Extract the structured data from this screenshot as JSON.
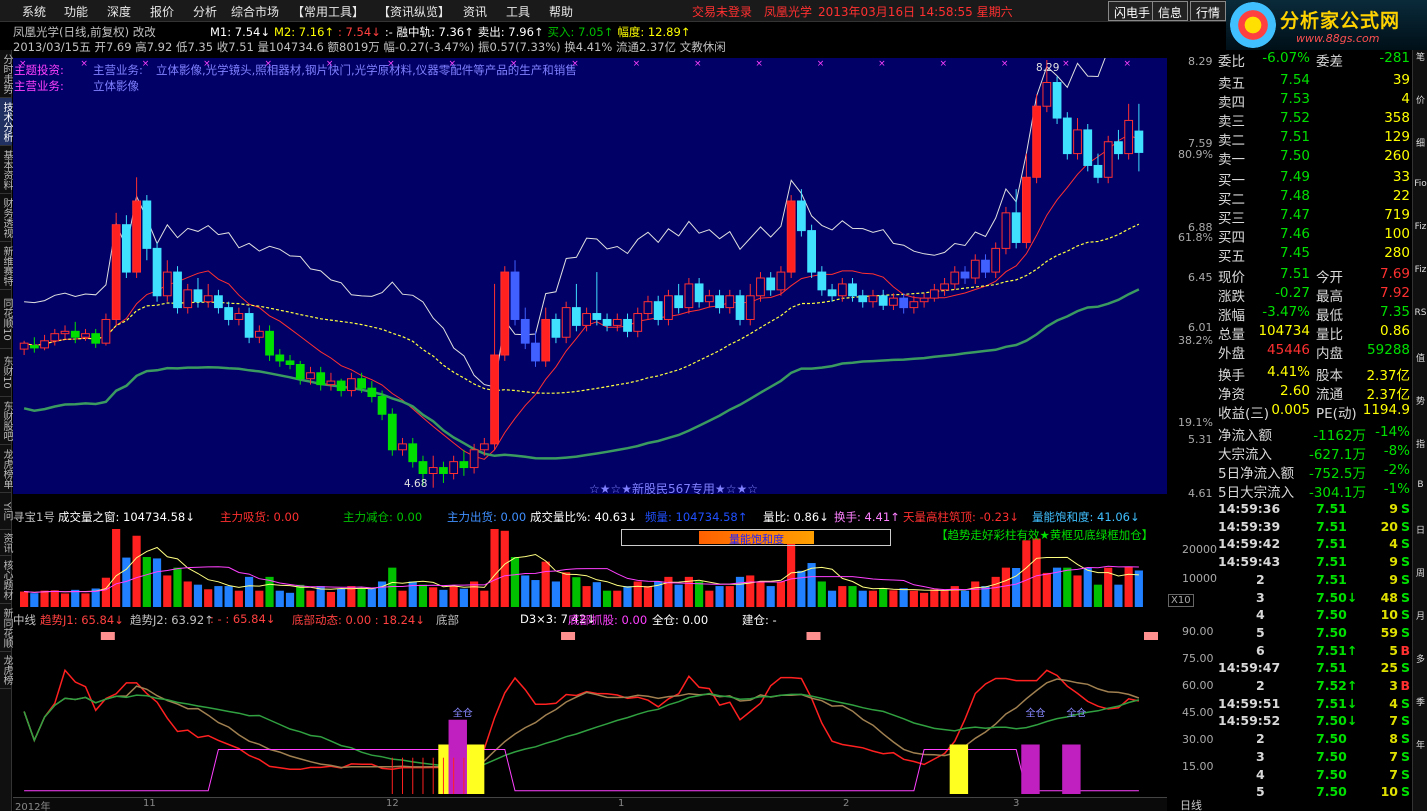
{
  "menu": [
    "系统",
    "功能",
    "深度",
    "报价",
    "分析",
    "综合市场",
    "【常用工具】",
    "【资讯纵览】",
    "资讯",
    "工具",
    "帮助"
  ],
  "status": {
    "login": "交易未登录",
    "stock": "凤凰光学",
    "datetime": "2013年03月16日 14:58:55 星期六"
  },
  "buttons": [
    "闪电手",
    "信息",
    "行情"
  ],
  "logo": {
    "title": "分析家公式网",
    "url": "www.88gs.com"
  },
  "left_tabs": [
    "分时走势",
    "技术分析",
    "基本资料",
    "财务透视",
    "新维赛特",
    "同花顺10",
    "东财10",
    "东财股吧",
    "龙虎榜单",
    "Yi问",
    "资讯",
    "核心题材",
    "新同花顺",
    "龙虎榜"
  ],
  "header": {
    "title": "凤凰光学(日线,前复权) 改改",
    "ohlc": "2013/03/15五 开7.69 高7.92 低7.35 收7.51 量104734.6 额8019万 幅-0.27(-3.47%) 振0.57(7.33%) 换4.41% 流通2.37亿 文教休闲",
    "indicators": [
      {
        "text": "M1: 7.54↓",
        "color": "#ffffff"
      },
      {
        "text": "M2: 7.16↑",
        "color": "#ffff00"
      },
      {
        "text": ": 7.54↓",
        "color": "#ff4040"
      },
      {
        "text": ":- 融中轨: 7.36↑",
        "color": "#ffffff"
      },
      {
        "text": "卖出: 7.96↑",
        "color": "#ffffff"
      },
      {
        "text": "买入: 7.05↑",
        "color": "#00c000"
      },
      {
        "text": "幅度: 12.89↑",
        "color": "#ffff00"
      }
    ]
  },
  "main_panel": {
    "theme_label": "主题投资:",
    "theme_sub": "主营业务:",
    "theme_text": "立体影像,光学镜头,照相器材,钢片快门,光学原材料,仪器零配件等产品的生产和销售",
    "business_label": "主营业务:",
    "business_text": "立体影像",
    "caption": "☆★☆★新股民567专用★☆★☆",
    "high_label": "8.29",
    "low_label": "4.68",
    "price_axis": [
      "8.29",
      "7.59",
      "6.88",
      "6.45",
      "6.01",
      "5.31",
      "4.61"
    ],
    "pct_axis": [
      "80.9%",
      "61.8%",
      "38.2%",
      "19.1%"
    ]
  },
  "vol_panel": {
    "items": [
      {
        "text": "寻宝1号",
        "color": "#c0c0c0"
      },
      {
        "text": "成交量之窗: 104734.58↓",
        "color": "#ffffff"
      },
      {
        "text": "主力吸货: 0.00",
        "color": "#ff3030"
      },
      {
        "text": "主力减仓: 0.00",
        "color": "#00c000"
      },
      {
        "text": "主力出货: 0.00",
        "color": "#4090ff"
      },
      {
        "text": "成交量比%: 40.63↓",
        "color": "#ffffff"
      },
      {
        "text": "频量: 104734.58↑",
        "color": "#2050ff"
      },
      {
        "text": "量比: 0.86↓",
        "color": "#ffffff"
      },
      {
        "text": "换手: 4.41↑",
        "color": "#ff80ff"
      },
      {
        "text": "天量高柱筑顶: -0.23↓",
        "color": "#ff3030"
      },
      {
        "text": "量能饱和度: 41.06↓",
        "color": "#40c0ff"
      }
    ],
    "box_label": "量能饱和度",
    "note": "【趋势走好彩柱有效★黄框见底绿框加仓】",
    "axis": [
      "20000",
      "10000"
    ],
    "unit": "X10"
  },
  "osc_panel": {
    "items": [
      {
        "text": "中线",
        "color": "#c0c0c0"
      },
      {
        "text": "趋势J1: 65.84↓",
        "color": "#ff4040"
      },
      {
        "text": "趋势J2: 63.92↑",
        "color": "#c0c0c0"
      },
      {
        "text": ": - : 65.84↓",
        "color": "#ff4040"
      },
      {
        "text": "底部动态: 0.00 : 18.24↓",
        "color": "#ff4040"
      },
      {
        "text": "底部",
        "color": "#c0c0c0"
      },
      {
        "text": "D3×3: 7.42↓",
        "color": "#ffffff"
      },
      {
        "text": "底部抓股: 0.00",
        "color": "#ff40ff"
      },
      {
        "text": "全仓: 0.00",
        "color": "#ffffff"
      },
      {
        "text": "建仓: -",
        "color": "#ffffff"
      }
    ],
    "axis": [
      "90.00",
      "75.00",
      "60.00",
      "45.00",
      "30.00",
      "15.00"
    ],
    "full_label": "全仓"
  },
  "x_axis": [
    "2012年",
    "11",
    "12",
    "1",
    "2",
    "3"
  ],
  "period": "日线",
  "quote": {
    "wei": {
      "label": "委比",
      "value": "-6.07%",
      "label2": "委差",
      "value2": "-281"
    },
    "asks": [
      {
        "label": "卖五",
        "price": "7.54",
        "vol": "39"
      },
      {
        "label": "卖四",
        "price": "7.53",
        "vol": "4"
      },
      {
        "label": "卖三",
        "price": "7.52",
        "vol": "358"
      },
      {
        "label": "卖二",
        "price": "7.51",
        "vol": "129"
      },
      {
        "label": "卖一",
        "price": "7.50",
        "vol": "260"
      }
    ],
    "bids": [
      {
        "label": "买一",
        "price": "7.49",
        "vol": "33"
      },
      {
        "label": "买二",
        "price": "7.48",
        "vol": "22"
      },
      {
        "label": "买三",
        "price": "7.47",
        "vol": "719"
      },
      {
        "label": "买四",
        "price": "7.46",
        "vol": "100"
      },
      {
        "label": "买五",
        "price": "7.45",
        "vol": "280"
      }
    ],
    "stats1": [
      {
        "l": "现价",
        "v": "7.51",
        "c": "#00e000",
        "l2": "今开",
        "v2": "7.69",
        "c2": "#ff3030"
      },
      {
        "l": "涨跌",
        "v": "-0.27",
        "c": "#00e000",
        "l2": "最高",
        "v2": "7.92",
        "c2": "#ff3030"
      },
      {
        "l": "涨幅",
        "v": "-3.47%",
        "c": "#00e000",
        "l2": "最低",
        "v2": "7.35",
        "c2": "#00e000"
      },
      {
        "l": "总量",
        "v": "104734",
        "c": "#ffff00",
        "l2": "量比",
        "v2": "0.86",
        "c2": "#ffff00"
      },
      {
        "l": "外盘",
        "v": "45446",
        "c": "#ff3030",
        "l2": "内盘",
        "v2": "59288",
        "c2": "#00e000"
      }
    ],
    "stats2": [
      {
        "l": "换手",
        "v": "4.41%",
        "c": "#ffff00",
        "l2": "股本",
        "v2": "2.37亿",
        "c2": "#ffff00"
      },
      {
        "l": "净资",
        "v": "2.60",
        "c": "#ffff00",
        "l2": "流通",
        "v2": "2.37亿",
        "c2": "#ffff00"
      },
      {
        "l": "收益(三)",
        "v": "0.005",
        "c": "#ffff00",
        "l2": "PE(动)",
        "v2": "1194.9",
        "c2": "#ffff00"
      }
    ],
    "flows": [
      {
        "l": "净流入额",
        "v": "-1162万",
        "v2": "-14%"
      },
      {
        "l": "大宗流入",
        "v": "-627.1万",
        "v2": "-8%"
      },
      {
        "l": "5日净流入额",
        "v": "-752.5万",
        "v2": "-2%"
      },
      {
        "l": "5日大宗流入",
        "v": "-304.1万",
        "v2": "-1%"
      }
    ]
  },
  "ticks": [
    {
      "t": "14:59:36",
      "p": "7.51",
      "v": "9",
      "bs": "S"
    },
    {
      "t": "14:59:39",
      "p": "7.51",
      "v": "20",
      "bs": "S"
    },
    {
      "t": "14:59:42",
      "p": "7.51",
      "v": "4",
      "bs": "S"
    },
    {
      "t": "14:59:43",
      "p": "7.51",
      "v": "9",
      "bs": "S"
    },
    {
      "t": "2",
      "p": "7.51",
      "v": "9",
      "bs": "S"
    },
    {
      "t": "3",
      "p": "7.50↓",
      "v": "48",
      "bs": "S"
    },
    {
      "t": "4",
      "p": "7.50",
      "v": "10",
      "bs": "S"
    },
    {
      "t": "5",
      "p": "7.50",
      "v": "59",
      "bs": "S"
    },
    {
      "t": "6",
      "p": "7.51↑",
      "v": "5",
      "bs": "B"
    },
    {
      "t": "14:59:47",
      "p": "7.51",
      "v": "25",
      "bs": "S"
    },
    {
      "t": "2",
      "p": "7.52↑",
      "v": "3",
      "bs": "B"
    },
    {
      "t": "14:59:51",
      "p": "7.51↓",
      "v": "4",
      "bs": "S"
    },
    {
      "t": "14:59:52",
      "p": "7.50↓",
      "v": "7",
      "bs": "S"
    },
    {
      "t": "2",
      "p": "7.50",
      "v": "8",
      "bs": "S"
    },
    {
      "t": "3",
      "p": "7.50",
      "v": "7",
      "bs": "S"
    },
    {
      "t": "4",
      "p": "7.50",
      "v": "7",
      "bs": "S"
    },
    {
      "t": "5",
      "p": "7.50",
      "v": "10",
      "bs": "S"
    }
  ],
  "far_right": [
    "笔",
    "价",
    "细",
    "Fio",
    "Fiz",
    "Fiz",
    "RS",
    "值",
    "势",
    "指",
    "B",
    "日",
    "周",
    "月",
    "多",
    "季",
    "年"
  ],
  "chart_data": {
    "type": "candlestick",
    "price_min": 4.61,
    "price_max": 8.29,
    "candles": [
      [
        5.85,
        5.9,
        5.8,
        5.92
      ],
      [
        5.88,
        5.86,
        5.82,
        5.95
      ],
      [
        5.86,
        5.92,
        5.84,
        5.97
      ],
      [
        5.92,
        5.98,
        5.88,
        6.02
      ],
      [
        5.98,
        6.0,
        5.93,
        6.05
      ],
      [
        6.0,
        5.95,
        5.9,
        6.08
      ],
      [
        5.95,
        5.98,
        5.92,
        6.02
      ],
      [
        5.98,
        5.9,
        5.86,
        6.02
      ],
      [
        5.9,
        6.1,
        5.88,
        6.15
      ],
      [
        6.1,
        6.9,
        6.05,
        7.0
      ],
      [
        6.9,
        6.5,
        6.45,
        6.98
      ],
      [
        6.5,
        7.1,
        6.45,
        7.3
      ],
      [
        7.1,
        6.7,
        6.6,
        7.15
      ],
      [
        6.7,
        6.3,
        6.25,
        6.75
      ],
      [
        6.3,
        6.5,
        6.25,
        6.6
      ],
      [
        6.5,
        6.2,
        6.15,
        6.55
      ],
      [
        6.2,
        6.35,
        6.15,
        6.4
      ],
      [
        6.35,
        6.25,
        6.2,
        6.45
      ],
      [
        6.25,
        6.3,
        6.2,
        6.4
      ],
      [
        6.3,
        6.2,
        6.15,
        6.35
      ],
      [
        6.2,
        6.1,
        6.05,
        6.25
      ],
      [
        6.1,
        6.15,
        6.05,
        6.2
      ],
      [
        6.15,
        5.95,
        5.9,
        6.2
      ],
      [
        5.95,
        6.0,
        5.9,
        6.05
      ],
      [
        6.0,
        5.8,
        5.75,
        6.05
      ],
      [
        5.8,
        5.75,
        5.7,
        5.85
      ],
      [
        5.75,
        5.72,
        5.68,
        5.8
      ],
      [
        5.72,
        5.6,
        5.55,
        5.75
      ],
      [
        5.6,
        5.65,
        5.55,
        5.7
      ],
      [
        5.65,
        5.55,
        5.5,
        5.7
      ],
      [
        5.55,
        5.58,
        5.5,
        5.65
      ],
      [
        5.58,
        5.5,
        5.45,
        5.6
      ],
      [
        5.5,
        5.6,
        5.45,
        5.65
      ],
      [
        5.6,
        5.52,
        5.48,
        5.65
      ],
      [
        5.52,
        5.45,
        5.4,
        5.58
      ],
      [
        5.45,
        5.3,
        5.25,
        5.5
      ],
      [
        5.3,
        5.0,
        4.95,
        5.35
      ],
      [
        5.0,
        5.05,
        4.95,
        5.1
      ],
      [
        5.05,
        4.9,
        4.85,
        5.1
      ],
      [
        4.9,
        4.8,
        4.7,
        4.95
      ],
      [
        4.8,
        4.85,
        4.68,
        4.95
      ],
      [
        4.85,
        4.8,
        4.72,
        4.9
      ],
      [
        4.8,
        4.9,
        4.75,
        4.95
      ],
      [
        4.9,
        4.85,
        4.78,
        5.0
      ],
      [
        4.85,
        5.0,
        4.8,
        5.05
      ],
      [
        5.0,
        5.05,
        4.95,
        5.1
      ],
      [
        5.05,
        5.8,
        5.0,
        6.4
      ],
      [
        5.8,
        6.5,
        5.75,
        6.55
      ],
      [
        6.5,
        6.1,
        6.05,
        6.6
      ],
      [
        6.1,
        5.9,
        5.85,
        6.2
      ],
      [
        5.9,
        5.75,
        5.7,
        6.0
      ],
      [
        5.75,
        6.1,
        5.7,
        6.2
      ],
      [
        6.1,
        5.95,
        5.9,
        6.15
      ],
      [
        5.95,
        6.2,
        5.9,
        6.25
      ],
      [
        6.2,
        6.05,
        6.0,
        6.4
      ],
      [
        6.05,
        6.15,
        6.0,
        6.2
      ],
      [
        6.15,
        6.1,
        6.05,
        6.5
      ],
      [
        6.1,
        6.05,
        6.0,
        6.15
      ],
      [
        6.05,
        6.1,
        6.0,
        6.15
      ],
      [
        6.1,
        6.0,
        5.95,
        6.15
      ],
      [
        6.0,
        6.15,
        5.95,
        6.2
      ],
      [
        6.15,
        6.25,
        6.1,
        6.3
      ],
      [
        6.25,
        6.1,
        6.05,
        6.3
      ],
      [
        6.1,
        6.3,
        6.05,
        6.35
      ],
      [
        6.3,
        6.2,
        6.15,
        6.4
      ],
      [
        6.2,
        6.4,
        6.15,
        6.45
      ],
      [
        6.4,
        6.25,
        6.2,
        6.45
      ],
      [
        6.25,
        6.3,
        6.2,
        6.35
      ],
      [
        6.3,
        6.2,
        6.15,
        6.35
      ],
      [
        6.2,
        6.3,
        6.15,
        6.35
      ],
      [
        6.3,
        6.1,
        6.05,
        6.35
      ],
      [
        6.1,
        6.3,
        6.05,
        6.4
      ],
      [
        6.3,
        6.45,
        6.25,
        6.5
      ],
      [
        6.45,
        6.35,
        6.3,
        6.5
      ],
      [
        6.35,
        6.5,
        6.3,
        6.55
      ],
      [
        6.5,
        7.1,
        6.45,
        7.15
      ],
      [
        7.1,
        6.85,
        6.8,
        7.2
      ],
      [
        6.85,
        6.5,
        6.45,
        6.9
      ],
      [
        6.5,
        6.35,
        6.3,
        6.55
      ],
      [
        6.35,
        6.3,
        6.25,
        6.4
      ],
      [
        6.3,
        6.4,
        6.25,
        6.45
      ],
      [
        6.4,
        6.3,
        6.25,
        6.45
      ],
      [
        6.3,
        6.25,
        6.2,
        6.35
      ],
      [
        6.25,
        6.3,
        6.2,
        6.35
      ],
      [
        6.3,
        6.22,
        6.18,
        6.35
      ],
      [
        6.22,
        6.28,
        6.18,
        6.32
      ],
      [
        6.28,
        6.2,
        6.15,
        6.32
      ],
      [
        6.2,
        6.25,
        6.15,
        6.3
      ],
      [
        6.25,
        6.28,
        6.2,
        6.32
      ],
      [
        6.28,
        6.35,
        6.25,
        6.4
      ],
      [
        6.35,
        6.4,
        6.3,
        6.45
      ],
      [
        6.4,
        6.5,
        6.35,
        6.55
      ],
      [
        6.5,
        6.45,
        6.4,
        6.55
      ],
      [
        6.45,
        6.6,
        6.4,
        6.65
      ],
      [
        6.6,
        6.5,
        6.45,
        6.65
      ],
      [
        6.5,
        6.7,
        6.45,
        6.75
      ],
      [
        6.7,
        7.0,
        6.65,
        7.05
      ],
      [
        7.0,
        6.75,
        6.7,
        7.2
      ],
      [
        6.75,
        7.3,
        6.7,
        7.5
      ],
      [
        7.3,
        7.9,
        7.25,
        8.0
      ],
      [
        7.9,
        8.1,
        7.85,
        8.29
      ],
      [
        8.1,
        7.8,
        7.75,
        8.15
      ],
      [
        7.8,
        7.5,
        7.45,
        7.85
      ],
      [
        7.5,
        7.7,
        7.45,
        7.8
      ],
      [
        7.7,
        7.4,
        7.35,
        7.75
      ],
      [
        7.4,
        7.3,
        7.25,
        7.5
      ],
      [
        7.3,
        7.6,
        7.25,
        7.65
      ],
      [
        7.6,
        7.5,
        7.45,
        7.7
      ],
      [
        7.5,
        7.78,
        7.45,
        7.92
      ],
      [
        7.69,
        7.51,
        7.35,
        7.92
      ]
    ]
  }
}
